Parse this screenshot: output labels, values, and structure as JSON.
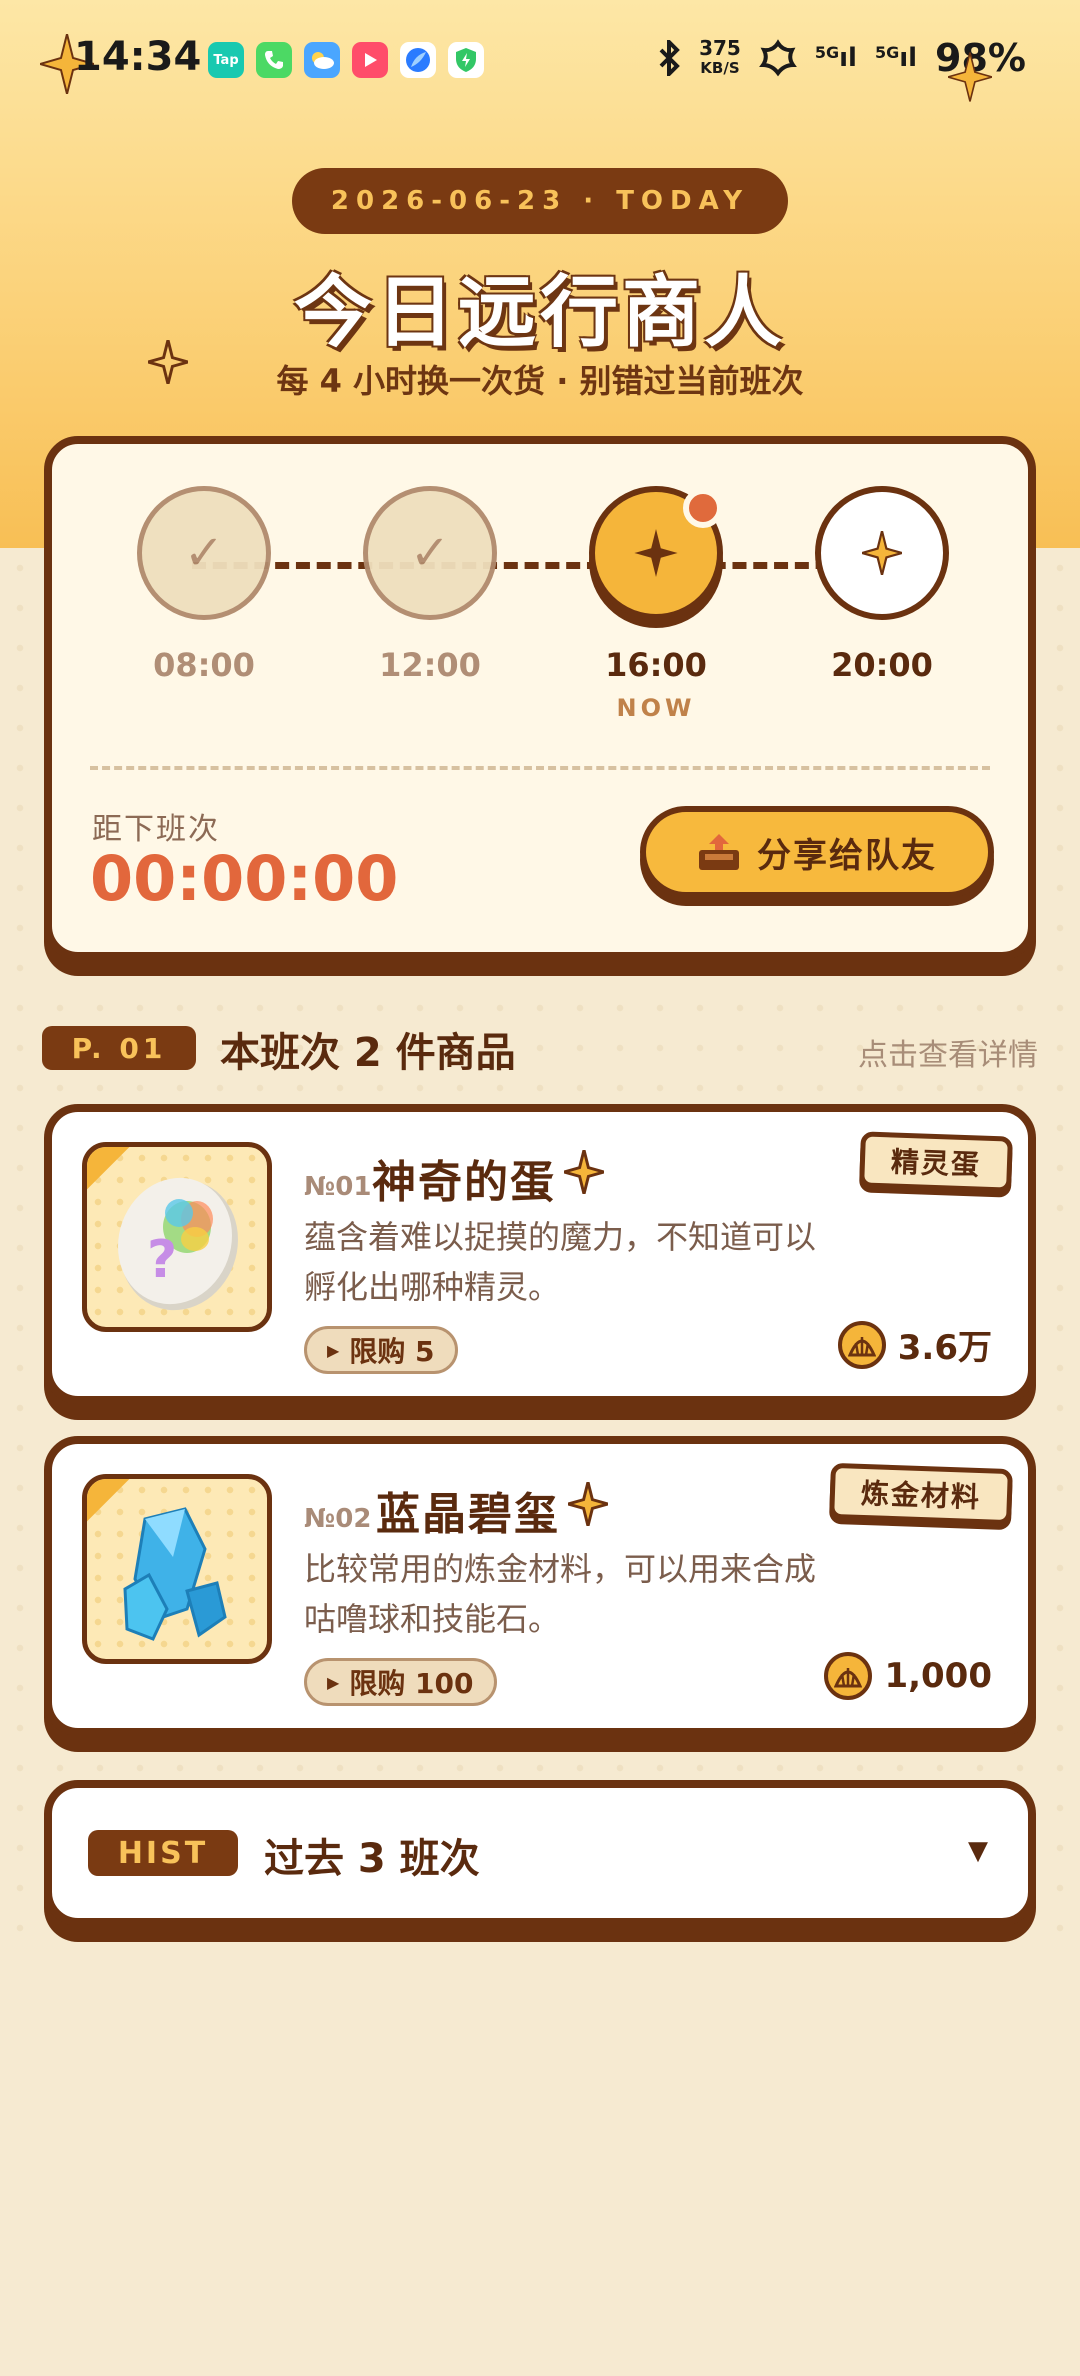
{
  "status_bar": {
    "time": "14:34",
    "net_speed": "375",
    "net_unit": "KB/S",
    "signal1": "5G",
    "signal2": "5G",
    "battery": "98%",
    "apps": [
      {
        "name": "taptap-app-icon",
        "label": "Tap",
        "color": "#19c9b0"
      },
      {
        "name": "phone-app-icon",
        "label": "",
        "color": "#4cd964"
      },
      {
        "name": "weather-app-icon",
        "label": "",
        "color": "#4aa6ff"
      },
      {
        "name": "video-app-icon",
        "label": "",
        "color": "#ff4d6a"
      },
      {
        "name": "browser-app-icon",
        "label": "",
        "color": "#2a7bff"
      },
      {
        "name": "security-app-icon",
        "label": "",
        "color": "#32c766"
      }
    ]
  },
  "header": {
    "date_pill": "2026-06-23 · TODAY",
    "title": "今日远行商人",
    "subtitle": "每 4 小时换一次货 · 别错过当前班次"
  },
  "timeline": {
    "slots": [
      {
        "time": "08:00",
        "state": "past"
      },
      {
        "time": "12:00",
        "state": "past"
      },
      {
        "time": "16:00",
        "state": "now",
        "now_label": "NOW"
      },
      {
        "time": "20:00",
        "state": "future"
      }
    ]
  },
  "countdown": {
    "label": "距下班次",
    "value": "00:00:00"
  },
  "share_button": {
    "label": "分享给队友"
  },
  "section": {
    "tag": "P. 01",
    "title": "本班次 2 件商品",
    "link": "点击查看详情"
  },
  "items": [
    {
      "no": "№01",
      "name": "神奇的蛋",
      "badge": "精灵蛋",
      "desc_line1": "蕴含着难以捉摸的魔力，不知道可以",
      "desc_line2": "孵化出哪种精灵。",
      "limit": "限购 5",
      "price": "3.6万"
    },
    {
      "no": "№02",
      "name": "蓝晶碧玺",
      "badge": "炼金材料",
      "desc_line1": "比较常用的炼金材料，可以用来合成",
      "desc_line2": "咕噜球和技能石。",
      "limit": "限购 100",
      "price": "1,000"
    }
  ],
  "history": {
    "tag": "HIST",
    "title": "过去 3 班次",
    "caret": "▼"
  },
  "colors": {
    "accent": "#f5b53a",
    "dark_brown": "#6b3210",
    "countdown": "#e2673c",
    "now_dot": "#e06a3c"
  }
}
